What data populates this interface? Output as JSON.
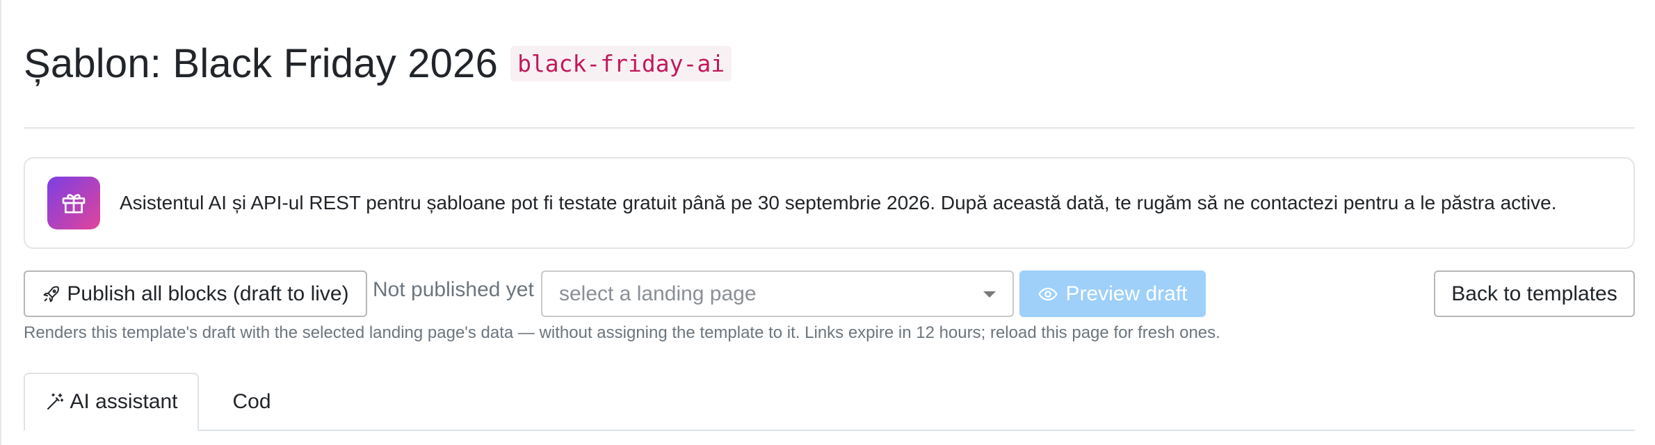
{
  "header": {
    "title": "Șablon: Black Friday 2026",
    "slug": "black-friday-ai"
  },
  "notice": {
    "icon": "gift-icon",
    "text": "Asistentul AI și API-ul REST pentru șabloane pot fi testate gratuit până pe 30 septembrie 2026. După această dată, te rugăm să ne contactezi pentru a le păstra active.",
    "gradient_start": "#7b3fe4",
    "gradient_end": "#e2449a"
  },
  "toolbar": {
    "publish_label": "Publish all blocks (draft to live)",
    "publish_icon": "rocket-icon",
    "status": "Not published yet",
    "landing_select_placeholder": "select a landing page",
    "preview_label": "Preview draft",
    "preview_icon": "eye-icon",
    "preview_color": "#9ed0fa",
    "back_label": "Back to templates",
    "helper": "Renders this template's draft with the selected landing page's data — without assigning the template to it. Links expire in 12 hours; reload this page for fresh ones."
  },
  "tabs": [
    {
      "label": "AI assistant",
      "icon": "magic-wand-icon",
      "active": true
    },
    {
      "label": "Cod",
      "active": false
    }
  ]
}
